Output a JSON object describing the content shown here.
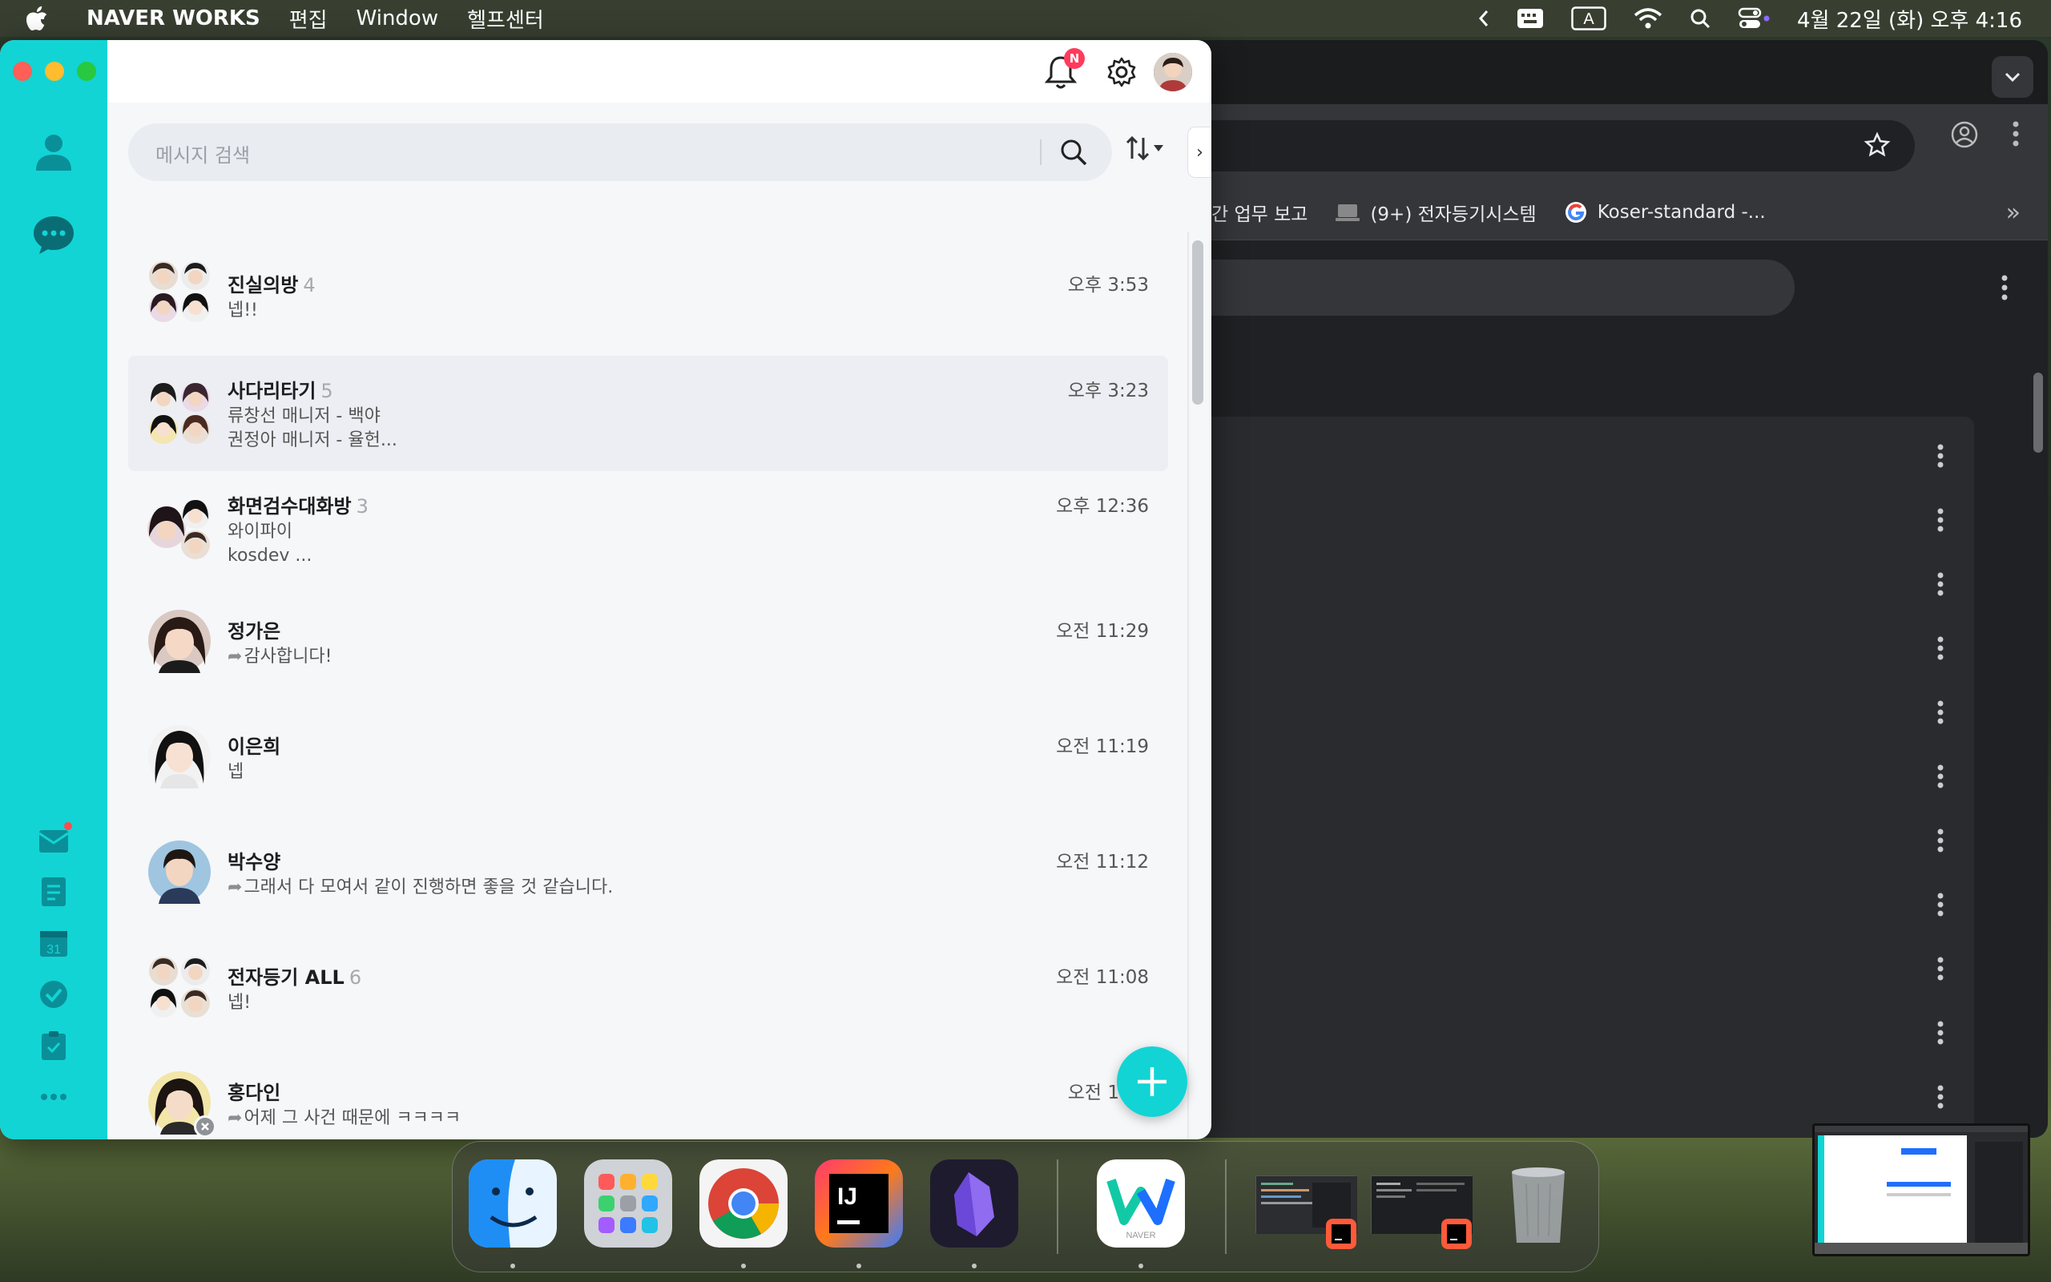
{
  "menubar": {
    "app_name": "NAVER WORKS",
    "menus": [
      "편집",
      "Window",
      "헬프센터"
    ],
    "clock": "4월 22일 (화) 오후 4:16",
    "input_indicator": "A"
  },
  "browser": {
    "bookmarks": [
      {
        "label": "간 업무 보고",
        "icon": "folder-icon"
      },
      {
        "label": "(9+) 전자등기시스템",
        "icon": "laptop-icon"
      },
      {
        "label": "Koser-standard -...",
        "icon": "google-icon"
      }
    ],
    "more_label": "»"
  },
  "naverworks": {
    "notification_badge": "N",
    "search_placeholder": "메시지 검색",
    "expander_label": "›",
    "chats": [
      {
        "name": "진실의방",
        "count": "4",
        "time": "오후 3:53",
        "lines": [
          "넵!!"
        ],
        "forwarded": false,
        "active": false,
        "avatar": "group"
      },
      {
        "name": "사다리타기",
        "count": "5",
        "time": "오후 3:23",
        "lines": [
          "류창선 매니저 - 백야",
          "권정아 매니저 - 율헌..."
        ],
        "forwarded": false,
        "active": true,
        "avatar": "group"
      },
      {
        "name": "화면검수대화방",
        "count": "3",
        "time": "오후 12:36",
        "lines": [
          "와이파이",
          "kosdev ..."
        ],
        "forwarded": false,
        "active": false,
        "avatar": "group3"
      },
      {
        "name": "정가은",
        "count": "",
        "time": "오전 11:29",
        "lines": [
          "감사합니다!"
        ],
        "forwarded": true,
        "active": false,
        "avatar": "person"
      },
      {
        "name": "이은희",
        "count": "",
        "time": "오전 11:19",
        "lines": [
          "넵"
        ],
        "forwarded": false,
        "active": false,
        "avatar": "person"
      },
      {
        "name": "박수양",
        "count": "",
        "time": "오전 11:12",
        "lines": [
          "그래서 다 모여서 같이 진행하면 좋을 것 같습니다."
        ],
        "forwarded": true,
        "active": false,
        "avatar": "person"
      },
      {
        "name": "전자등기 ALL",
        "count": "6",
        "time": "오전 11:08",
        "lines": [
          "넵!"
        ],
        "forwarded": false,
        "active": false,
        "avatar": "group"
      },
      {
        "name": "홍다인",
        "count": "",
        "time": "오전 10:0",
        "lines": [
          "어제 그 사건 때문에 ㅋㅋㅋㅋ"
        ],
        "forwarded": true,
        "active": false,
        "avatar": "person-away"
      }
    ]
  },
  "dock": {
    "apps": [
      "Finder",
      "Launchpad",
      "Chrome",
      "IntelliJ IDEA",
      "Obsidian",
      "NAVER WORKS"
    ],
    "naver_label": "NAVER",
    "intellij_label": "IJ"
  },
  "colors": {
    "accent": "#12d4d4",
    "badge": "#ff3b5c"
  }
}
